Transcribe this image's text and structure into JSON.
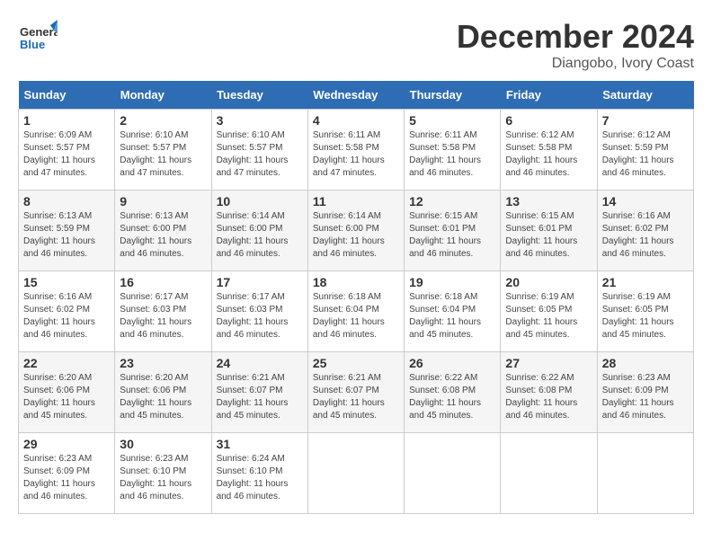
{
  "header": {
    "logo_text_general": "General",
    "logo_text_blue": "Blue",
    "main_title": "December 2024",
    "subtitle": "Diangobo, Ivory Coast"
  },
  "calendar": {
    "days_of_week": [
      "Sunday",
      "Monday",
      "Tuesday",
      "Wednesday",
      "Thursday",
      "Friday",
      "Saturday"
    ],
    "weeks": [
      [
        null,
        null,
        null,
        null,
        null,
        null,
        null
      ]
    ],
    "cells": [
      {
        "day": 1,
        "col": 0,
        "sunrise": "6:09 AM",
        "sunset": "5:57 PM",
        "daylight": "11 hours and 47 minutes."
      },
      {
        "day": 2,
        "col": 1,
        "sunrise": "6:10 AM",
        "sunset": "5:57 PM",
        "daylight": "11 hours and 47 minutes."
      },
      {
        "day": 3,
        "col": 2,
        "sunrise": "6:10 AM",
        "sunset": "5:57 PM",
        "daylight": "11 hours and 47 minutes."
      },
      {
        "day": 4,
        "col": 3,
        "sunrise": "6:11 AM",
        "sunset": "5:58 PM",
        "daylight": "11 hours and 47 minutes."
      },
      {
        "day": 5,
        "col": 4,
        "sunrise": "6:11 AM",
        "sunset": "5:58 PM",
        "daylight": "11 hours and 46 minutes."
      },
      {
        "day": 6,
        "col": 5,
        "sunrise": "6:12 AM",
        "sunset": "5:58 PM",
        "daylight": "11 hours and 46 minutes."
      },
      {
        "day": 7,
        "col": 6,
        "sunrise": "6:12 AM",
        "sunset": "5:59 PM",
        "daylight": "11 hours and 46 minutes."
      },
      {
        "day": 8,
        "col": 0,
        "sunrise": "6:13 AM",
        "sunset": "5:59 PM",
        "daylight": "11 hours and 46 minutes."
      },
      {
        "day": 9,
        "col": 1,
        "sunrise": "6:13 AM",
        "sunset": "6:00 PM",
        "daylight": "11 hours and 46 minutes."
      },
      {
        "day": 10,
        "col": 2,
        "sunrise": "6:14 AM",
        "sunset": "6:00 PM",
        "daylight": "11 hours and 46 minutes."
      },
      {
        "day": 11,
        "col": 3,
        "sunrise": "6:14 AM",
        "sunset": "6:00 PM",
        "daylight": "11 hours and 46 minutes."
      },
      {
        "day": 12,
        "col": 4,
        "sunrise": "6:15 AM",
        "sunset": "6:01 PM",
        "daylight": "11 hours and 46 minutes."
      },
      {
        "day": 13,
        "col": 5,
        "sunrise": "6:15 AM",
        "sunset": "6:01 PM",
        "daylight": "11 hours and 46 minutes."
      },
      {
        "day": 14,
        "col": 6,
        "sunrise": "6:16 AM",
        "sunset": "6:02 PM",
        "daylight": "11 hours and 46 minutes."
      },
      {
        "day": 15,
        "col": 0,
        "sunrise": "6:16 AM",
        "sunset": "6:02 PM",
        "daylight": "11 hours and 46 minutes."
      },
      {
        "day": 16,
        "col": 1,
        "sunrise": "6:17 AM",
        "sunset": "6:03 PM",
        "daylight": "11 hours and 46 minutes."
      },
      {
        "day": 17,
        "col": 2,
        "sunrise": "6:17 AM",
        "sunset": "6:03 PM",
        "daylight": "11 hours and 46 minutes."
      },
      {
        "day": 18,
        "col": 3,
        "sunrise": "6:18 AM",
        "sunset": "6:04 PM",
        "daylight": "11 hours and 46 minutes."
      },
      {
        "day": 19,
        "col": 4,
        "sunrise": "6:18 AM",
        "sunset": "6:04 PM",
        "daylight": "11 hours and 45 minutes."
      },
      {
        "day": 20,
        "col": 5,
        "sunrise": "6:19 AM",
        "sunset": "6:05 PM",
        "daylight": "11 hours and 45 minutes."
      },
      {
        "day": 21,
        "col": 6,
        "sunrise": "6:19 AM",
        "sunset": "6:05 PM",
        "daylight": "11 hours and 45 minutes."
      },
      {
        "day": 22,
        "col": 0,
        "sunrise": "6:20 AM",
        "sunset": "6:06 PM",
        "daylight": "11 hours and 45 minutes."
      },
      {
        "day": 23,
        "col": 1,
        "sunrise": "6:20 AM",
        "sunset": "6:06 PM",
        "daylight": "11 hours and 45 minutes."
      },
      {
        "day": 24,
        "col": 2,
        "sunrise": "6:21 AM",
        "sunset": "6:07 PM",
        "daylight": "11 hours and 45 minutes."
      },
      {
        "day": 25,
        "col": 3,
        "sunrise": "6:21 AM",
        "sunset": "6:07 PM",
        "daylight": "11 hours and 45 minutes."
      },
      {
        "day": 26,
        "col": 4,
        "sunrise": "6:22 AM",
        "sunset": "6:08 PM",
        "daylight": "11 hours and 45 minutes."
      },
      {
        "day": 27,
        "col": 5,
        "sunrise": "6:22 AM",
        "sunset": "6:08 PM",
        "daylight": "11 hours and 46 minutes."
      },
      {
        "day": 28,
        "col": 6,
        "sunrise": "6:23 AM",
        "sunset": "6:09 PM",
        "daylight": "11 hours and 46 minutes."
      },
      {
        "day": 29,
        "col": 0,
        "sunrise": "6:23 AM",
        "sunset": "6:09 PM",
        "daylight": "11 hours and 46 minutes."
      },
      {
        "day": 30,
        "col": 1,
        "sunrise": "6:23 AM",
        "sunset": "6:10 PM",
        "daylight": "11 hours and 46 minutes."
      },
      {
        "day": 31,
        "col": 2,
        "sunrise": "6:24 AM",
        "sunset": "6:10 PM",
        "daylight": "11 hours and 46 minutes."
      }
    ]
  }
}
